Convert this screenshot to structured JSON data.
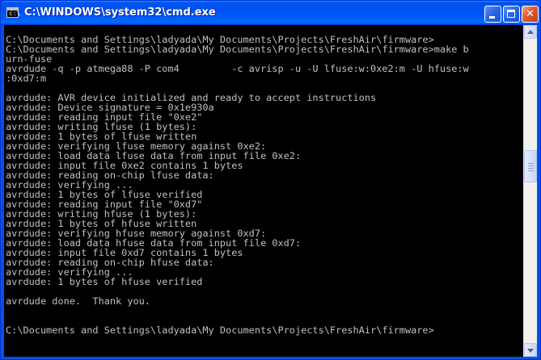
{
  "window": {
    "title": "C:\\WINDOWS\\system32\\cmd.exe",
    "icon": "console-icon",
    "controls": [
      "minimize-icon",
      "maximize-icon",
      "close-icon"
    ],
    "colors": {
      "titlebar": "#0054e3",
      "console_bg": "#000000",
      "console_text": "#c0c0c0"
    }
  },
  "console": {
    "lines": [
      "",
      "C:\\Documents and Settings\\ladyada\\My Documents\\Projects\\FreshAir\\firmware>",
      "C:\\Documents and Settings\\ladyada\\My Documents\\Projects\\FreshAir\\firmware>make b",
      "urn-fuse",
      "avrdude -q -p atmega88 -P com4         -c avrisp -u -U lfuse:w:0xe2:m -U hfuse:w",
      ":0xd7:m",
      "",
      "avrdude: AVR device initialized and ready to accept instructions",
      "avrdude: Device signature = 0x1e930a",
      "avrdude: reading input file \"0xe2\"",
      "avrdude: writing lfuse (1 bytes):",
      "avrdude: 1 bytes of lfuse written",
      "avrdude: verifying lfuse memory against 0xe2:",
      "avrdude: load data lfuse data from input file 0xe2:",
      "avrdude: input file 0xe2 contains 1 bytes",
      "avrdude: reading on-chip lfuse data:",
      "avrdude: verifying ...",
      "avrdude: 1 bytes of lfuse verified",
      "avrdude: reading input file \"0xd7\"",
      "avrdude: writing hfuse (1 bytes):",
      "avrdude: 1 bytes of hfuse written",
      "avrdude: verifying hfuse memory against 0xd7:",
      "avrdude: load data hfuse data from input file 0xd7:",
      "avrdude: input file 0xd7 contains 1 bytes",
      "avrdude: reading on-chip hfuse data:",
      "avrdude: verifying ...",
      "avrdude: 1 bytes of hfuse verified",
      "",
      "avrdude done.  Thank you.",
      "",
      "",
      "C:\\Documents and Settings\\ladyada\\My Documents\\Projects\\FreshAir\\firmware>"
    ]
  },
  "scrollbar": {
    "up_icon": "scroll-up-arrow-icon",
    "down_icon": "scroll-down-arrow-icon"
  }
}
